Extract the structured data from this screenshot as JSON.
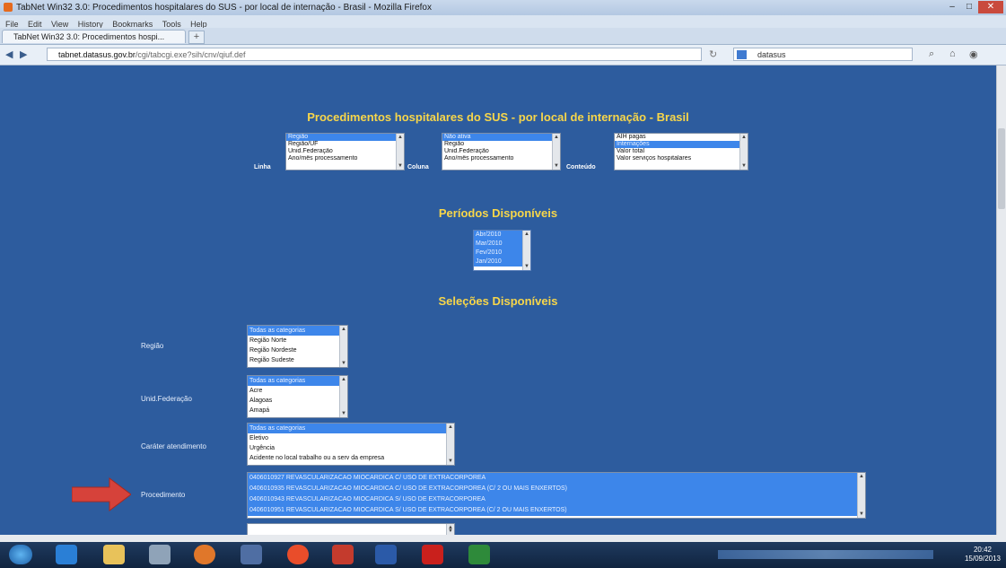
{
  "window": {
    "title": "TabNet Win32 3.0: Procedimentos hospitalares do SUS - por local de internação - Brasil - Mozilla Firefox",
    "menu": [
      "File",
      "Edit",
      "View",
      "History",
      "Bookmarks",
      "Tools",
      "Help"
    ],
    "tab_label": "TabNet Win32 3.0: Procedimentos hospi...",
    "new_tab": "+",
    "url_domain": "tabnet.datasus.gov.br",
    "url_path": "/cgi/tabcgi.exe?sih/cnv/qiuf.def",
    "search_text": "datasus"
  },
  "page": {
    "title": "Procedimentos hospitalares do SUS - por local de internação - Brasil",
    "linha_label": "Linha",
    "linha_options": [
      "Região",
      "Região/UF",
      "Unid.Federação",
      "Ano/mês processamento"
    ],
    "coluna_label": "Coluna",
    "coluna_options": [
      "Não ativa",
      "Região",
      "Unid.Federação",
      "Ano/mês processamento"
    ],
    "conteudo_label": "Conteúdo",
    "conteudo_options": [
      "AIH pagas",
      "Internações",
      "Valor total",
      "Valor serviços hospitalares"
    ],
    "periodos_title": "Períodos Disponíveis",
    "periodos": [
      "Abr/2010",
      "Mar/2010",
      "Fev/2010",
      "Jan/2010"
    ],
    "selecoes_title": "Seleções Disponíveis",
    "filters": [
      {
        "label": "Região",
        "options": [
          "Todas as categorias",
          "Região Norte",
          "Região Nordeste",
          "Região Sudeste"
        ]
      },
      {
        "label": "Unid.Federação",
        "options": [
          "Todas as categorias",
          "Acre",
          "Alagoas",
          "Amapá"
        ]
      },
      {
        "label": "Caráter atendimento",
        "options": [
          "Todas as categorias",
          "Eletivo",
          "Urgência",
          "Acidente no local trabalho ou a serv da empresa"
        ]
      },
      {
        "label": "Procedimento",
        "options": [
          "0406010927 REVASCULARIZACAO MIOCARDICA C/ USO DE EXTRACORPOREA",
          "0406010935 REVASCULARIZACAO MIOCARDICA C/ USO DE EXTRACORPOREA (C/ 2 OU MAIS ENXERTOS)",
          "0406010943 REVASCULARIZACAO MIOCARDICA S/ USO DE EXTRACORPOREA",
          "0406010951 REVASCULARIZACAO MIOCARDICA S/ USO DE EXTRACORPOREA (C/ 2 OU MAIS ENXERTOS)"
        ]
      }
    ]
  },
  "taskbar": {
    "time": "20:42",
    "date": "15/09/2013"
  },
  "colors": {
    "page_bg": "#2d5c9e",
    "title_yellow": "#f7d64a",
    "selected": "#3d86ea",
    "arrow": "#d6423a"
  }
}
